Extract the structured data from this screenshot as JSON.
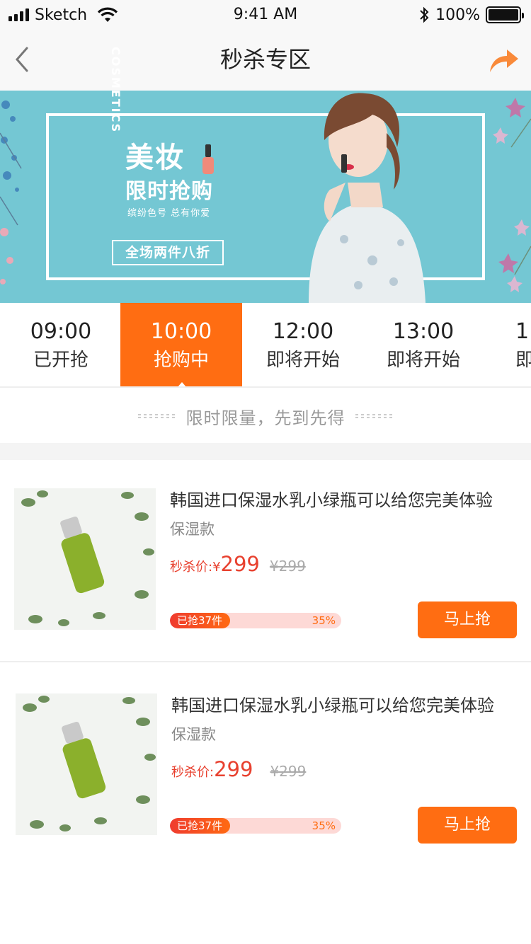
{
  "status_bar": {
    "carrier": "Sketch",
    "time": "9:41 AM",
    "battery": "100%"
  },
  "nav": {
    "title": "秒杀专区",
    "back_icon": "chevron-left-icon",
    "share_icon": "share-arrow-icon"
  },
  "banner": {
    "vertical_text": "COSMETICS",
    "title_line1": "美妆",
    "title_line2": "限时抢购",
    "subtitle": "缤纷色号 总有你爱",
    "tag": "全场两件八折"
  },
  "time_slots": [
    {
      "time": "09:00",
      "status": "已开抢"
    },
    {
      "time": "10:00",
      "status": "抢购中",
      "active": true
    },
    {
      "time": "12:00",
      "status": "即将开始"
    },
    {
      "time": "13:00",
      "status": "即将开始"
    },
    {
      "time": "1",
      "status": "即将开始"
    }
  ],
  "slogan": "限时限量，先到先得",
  "products": [
    {
      "name": "韩国进口保湿水乳小绿瓶可以给您完美体验",
      "spec": "保湿款",
      "price_label": "秒杀价:¥",
      "price": "299",
      "original_price": "¥299",
      "sold_text": "已抢37件",
      "progress_percent": "35%",
      "progress": 0.35,
      "button": "马上抢"
    },
    {
      "name": "韩国进口保湿水乳小绿瓶可以给您完美体验",
      "spec": "保湿款",
      "price_label": "秒杀价:",
      "price": "299",
      "original_price": "¥299",
      "sold_text": "已抢37件",
      "progress_percent": "35%",
      "progress": 0.35,
      "button": "马上抢"
    }
  ],
  "colors": {
    "accent": "#ff6d12",
    "price_red": "#e8412f",
    "banner_bg": "#74c7d3"
  }
}
